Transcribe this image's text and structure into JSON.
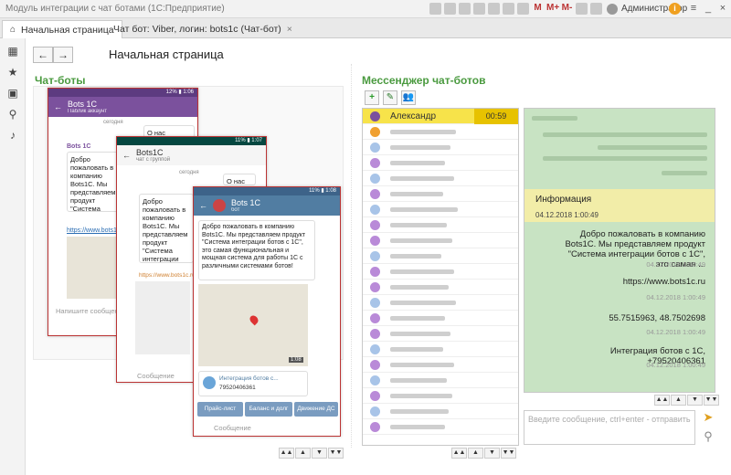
{
  "window": {
    "title": "Модуль интеграции с чат ботами  (1С:Предприятие)",
    "user": "Администратор",
    "info": "i",
    "m_labels": [
      "M",
      "M+",
      "M-"
    ],
    "win_controls": [
      "_",
      "□",
      "×"
    ]
  },
  "tabs": [
    {
      "label": "Начальная страница"
    },
    {
      "label": "Чат бот: Viber, логин: bots1c (Чат-бот)",
      "close": "×"
    }
  ],
  "nav": {
    "back": "←",
    "forward": "→"
  },
  "page_title": "Начальная страница",
  "left": {
    "heading": "Чат-боты",
    "viber": {
      "status": "12% ▮ 1:06",
      "title": "Bots 1C",
      "subtitle": "Паблик аккаунт",
      "sender": "Bots 1C",
      "today": "сегодня",
      "about": "О нас",
      "about_time": "1:06 чат",
      "message": "Добро пожаловать в компанию Bots1C. Мы представляем продукт \"Система интеграции ботов с 1С\", это самая функциональная и мощная система для работы 1С с различными системами ботов!",
      "link": "https://www.bots1c.ru",
      "input_placeholder": "Напишите сообщение..."
    },
    "whatsapp": {
      "status": "11% ▮ 1:07",
      "title": "Bots1C",
      "subtitle": "чат с группой",
      "today": "сегодня",
      "about": "О нас",
      "message": "Добро пожаловать в компанию Bots1C. Мы представляем продукт \"Система интеграции ботов с 1С\", это самая функциональная и мощная система для работы 1С с различными системами ботов!",
      "link": "https://www.bots1c.ru",
      "input_placeholder": "Сообщение"
    },
    "telegram": {
      "status": "11% ▮ 1:08",
      "title": "Bots 1C",
      "subtitle": "бот",
      "message": "Добро пожаловать в компанию Bots1C. Мы представляем продукт \"Система интеграции ботов с 1С\", это самая функциональная и мощная система для работы 1С с различными системами ботов!",
      "msg_time": "1:07",
      "map_time": "1:08",
      "contact_name": "Интеграция ботов с...",
      "contact_phone": "79520406361",
      "buttons": [
        "Прайс-лист",
        "Баланс и долг",
        "Движение ДС"
      ],
      "input_placeholder": "Сообщение"
    }
  },
  "right": {
    "heading": "Мессенджер чат-ботов",
    "toolbar": {
      "add": "+",
      "edit": "✎",
      "contacts": "👥"
    },
    "selected_contact": {
      "name": "Александр",
      "time": "00:59"
    },
    "messages": {
      "info_label": "Информация",
      "info_date": "04.12.2018 1:00:49",
      "items": [
        {
          "text": "Добро пожаловать в компанию Bots1C. Мы представляем продукт \"Система интеграции ботов с 1С\", это самая ...",
          "time": "04.12.2018 1:00:49"
        },
        {
          "text": "https://www.bots1c.ru",
          "time": "04.12.2018 1:00:49"
        },
        {
          "text": "55.7515963, 48.7502698",
          "time": "04.12.2018 1:00:49"
        },
        {
          "text": "Интеграция ботов с 1С, +79520406361",
          "time": "04.12.2018 1:00:49"
        }
      ]
    },
    "compose_placeholder": "Введите сообщение, ctrl+enter - отправить",
    "scroll": [
      "▲▲",
      "▲",
      "▼",
      "▼▼"
    ]
  },
  "colors": {
    "accent_green": "#4a9a3f",
    "viber": "#7b519d",
    "whatsapp": "#075e54",
    "telegram": "#517da2",
    "selected": "#f7e34a"
  }
}
